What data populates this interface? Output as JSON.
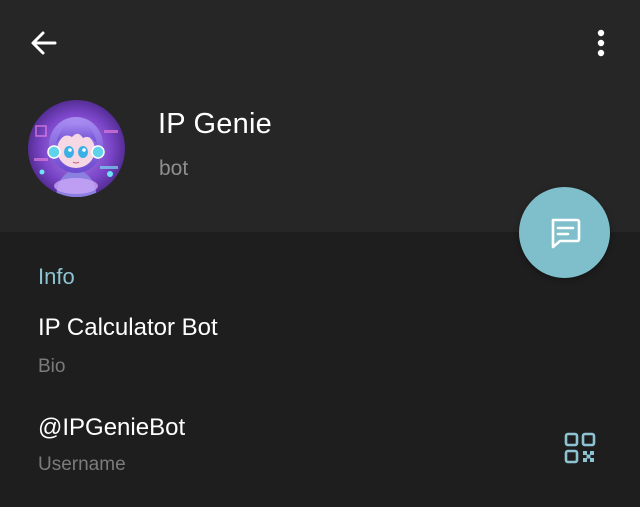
{
  "header": {
    "back_icon": "arrow-left-icon",
    "menu_icon": "more-vertical-icon"
  },
  "profile": {
    "name": "IP Genie",
    "status": "bot",
    "avatar_icon": "bot-avatar-image"
  },
  "fab": {
    "icon": "message-icon",
    "color": "#7fbfcb"
  },
  "info": {
    "section_title": "Info",
    "bio": {
      "value": "IP Calculator Bot",
      "label": "Bio"
    },
    "username": {
      "value": "@IPGenieBot",
      "label": "Username",
      "qr_icon": "qr-code-icon"
    }
  },
  "colors": {
    "accent": "#8dc3d2",
    "header_bg": "#262626",
    "body_bg": "#1e1e1e"
  }
}
